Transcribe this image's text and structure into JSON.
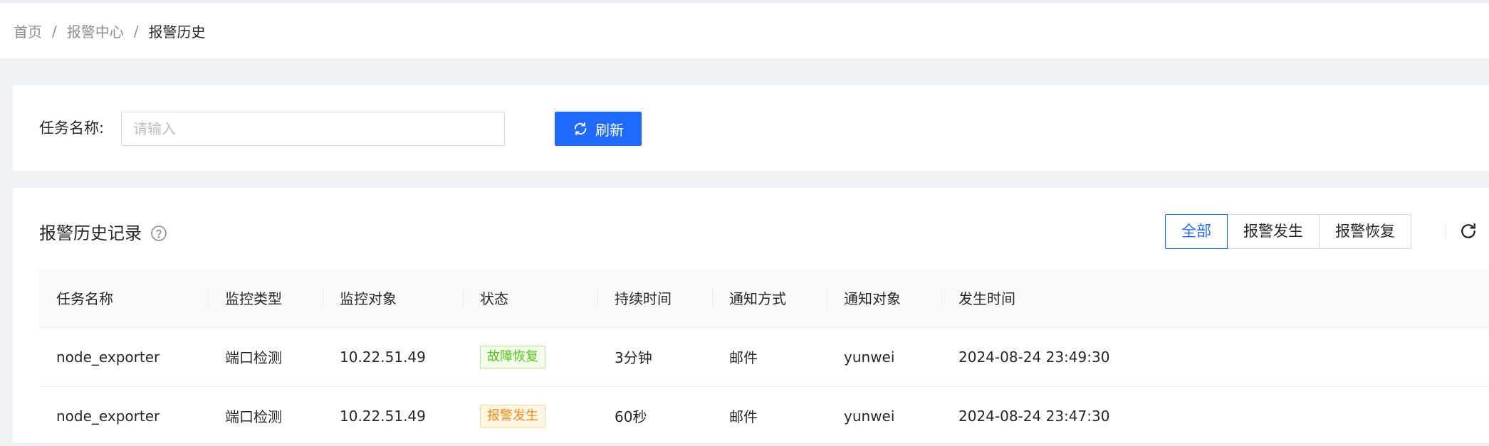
{
  "breadcrumb": {
    "items": [
      "首页",
      "报警中心",
      "报警历史"
    ],
    "separator": "/"
  },
  "search": {
    "label": "任务名称:",
    "value": "",
    "placeholder": "请输入",
    "refresh_label": "刷新",
    "refresh_icon": "sync-icon"
  },
  "card": {
    "title": "报警历史记录",
    "help_icon": "question-circle-icon",
    "filters": [
      "全部",
      "报警发生",
      "报警恢复"
    ],
    "active_filter": "全部",
    "reload_icon": "reload-icon",
    "density_icon": "column-height-icon"
  },
  "table": {
    "columns": [
      "任务名称",
      "监控类型",
      "监控对象",
      "状态",
      "持续时间",
      "通知方式",
      "通知对象",
      "发生时间"
    ],
    "rows": [
      {
        "task_name": "node_exporter",
        "monitor_type": "端口检测",
        "monitor_target": "10.22.51.49",
        "status": "故障恢复",
        "status_color": "#52c41a",
        "duration": "3分钟",
        "notify_method": "邮件",
        "notify_target": "yunwei",
        "occurred_at": "2024-08-24 23:49:30"
      },
      {
        "task_name": "node_exporter",
        "monitor_type": "端口检测",
        "monitor_target": "10.22.51.49",
        "status": "报警发生",
        "status_color": "#fa8c16",
        "duration": "60秒",
        "notify_method": "邮件",
        "notify_target": "yunwei",
        "occurred_at": "2024-08-24 23:47:30"
      }
    ]
  },
  "colors": {
    "primary": "#1f6bff",
    "background": "#f0f2f5"
  }
}
